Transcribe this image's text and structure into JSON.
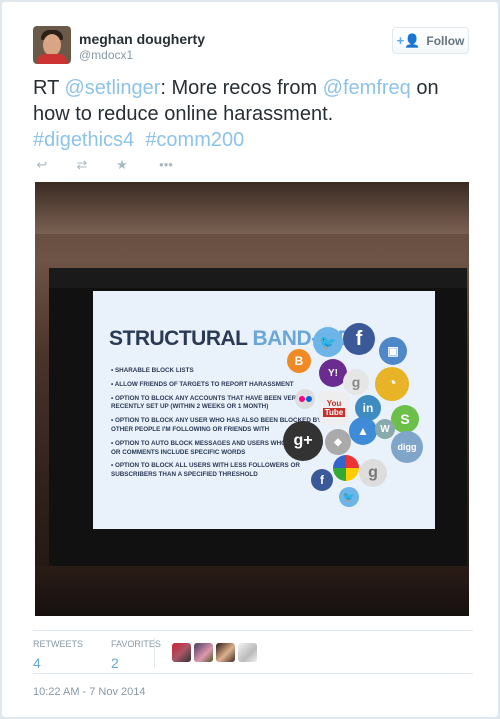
{
  "user": {
    "name": "meghan dougherty",
    "handle": "@mdocx1"
  },
  "follow_label": "Follow",
  "tweet": {
    "prefix": "RT ",
    "mention1": "@setlinger",
    "text1": ": More recos from ",
    "mention2": "@femfreq",
    "text2": " on how to reduce online harassment.",
    "hashtag1": "#digethics4",
    "hashtag2": "#comm200"
  },
  "actions": [
    {
      "icon": "reply-icon",
      "glyph": "↩"
    },
    {
      "icon": "retweet-icon",
      "glyph": "⇄"
    },
    {
      "icon": "favorite-icon",
      "glyph": "★"
    },
    {
      "icon": "more-icon",
      "glyph": "•••"
    }
  ],
  "slide": {
    "title_part1": "STRUCTURAL",
    "title_part2": "BAND-AIDS",
    "bullets": [
      "• Sharable block lists",
      "• Allow friends of targets to report harassment",
      "• Option to block any accounts that have been very recently set up (within 2 weeks or 1 month)",
      "• Option to block any user who has also been blocked by other people I'm following or friends with",
      "• Option to auto block messages and users whose replies or comments include specific words",
      "• Option to block all users with less followers or subscribers than a specified threshold"
    ]
  },
  "stats": {
    "retweets_label": "RETWEETS",
    "retweets_value": "4",
    "favorites_label": "FAVORITES",
    "favorites_value": "2"
  },
  "timestamp": "10:22 AM - 7 Nov 2014",
  "colors": {
    "link": "#8ec3e8",
    "accent": "#55acee"
  }
}
